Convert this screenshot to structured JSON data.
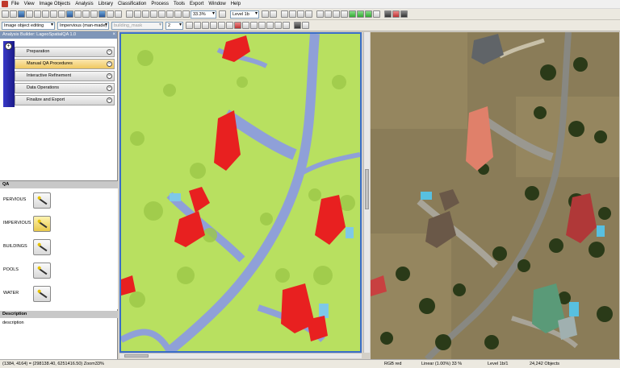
{
  "menubar": {
    "items": [
      "File",
      "View",
      "Image Objects",
      "Analysis",
      "Library",
      "Classification",
      "Process",
      "Tools",
      "Export",
      "Window",
      "Help"
    ]
  },
  "toolbar": {
    "zoom_value": "33.3%",
    "level_value": "Level 1b",
    "mode_value": "Image object editing",
    "class_value": "Impervious (man-made)",
    "thematic_value": "building_mask",
    "brush_value": "2"
  },
  "analysis_builder": {
    "title": "Analysis Builder: LageoSpatialQA 1.0",
    "steps": [
      "Preparation",
      "Manual QA Procedures",
      "Interactive Refinement",
      "Data Operations",
      "Finalize and Export"
    ],
    "active_index": 1
  },
  "qa": {
    "title": "QA",
    "rows": [
      {
        "label": "PERVIOUS",
        "active": false
      },
      {
        "label": "IMPERVIOUS",
        "active": true
      },
      {
        "label": "BUILDINGS",
        "active": false
      },
      {
        "label": "POOLS",
        "active": false
      },
      {
        "label": "WATER",
        "active": false
      }
    ]
  },
  "description": {
    "title": "Description",
    "text": "description"
  },
  "status": {
    "coords": "(1384, 4164) = (298138.40, 6251416.50)  Zoom33%",
    "bands": "RGB   red",
    "stretch": "Linear (1.00%)   33 %",
    "level": "Level 1b/1",
    "objects": "24,242 Objects"
  },
  "colors": {
    "pervious": "#b8e060",
    "impervious": "#8fa0d8",
    "building": "#e82020",
    "selection_border": "#3a6ec8"
  }
}
